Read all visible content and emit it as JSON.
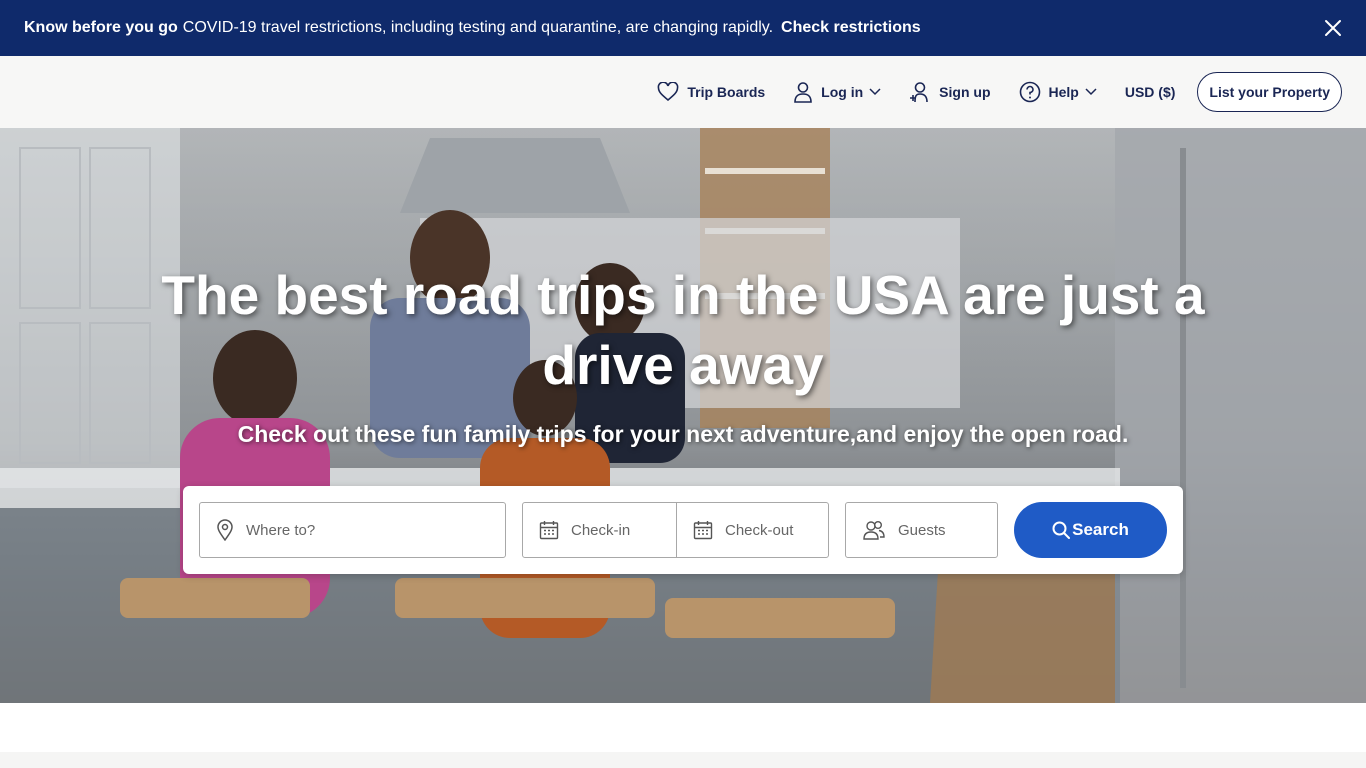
{
  "banner": {
    "bold": "Know before you go",
    "text": "COVID-19 travel restrictions, including testing and quarantine, are changing rapidly.",
    "link": "Check restrictions",
    "close_icon": "close-icon",
    "bg_color": "#0f2a6b"
  },
  "header": {
    "nav": {
      "trip_boards": "Trip Boards",
      "log_in": "Log in",
      "sign_up": "Sign up",
      "help": "Help",
      "currency": "USD ($)",
      "list_property": "List your Property"
    },
    "icons": [
      "heart-icon",
      "user-icon",
      "user-add-icon",
      "help-icon",
      "chevron-down-icon"
    ]
  },
  "hero": {
    "title": "The best road trips in the USA are just a drive away",
    "subtitle": "Check out these fun family trips for your next adventure,and enjoy the open road."
  },
  "search": {
    "where_placeholder": "Where to?",
    "checkin_placeholder": "Check-in",
    "checkout_placeholder": "Check-out",
    "guests_placeholder": "Guests",
    "button": "Search",
    "button_color": "#1f5bc6"
  }
}
